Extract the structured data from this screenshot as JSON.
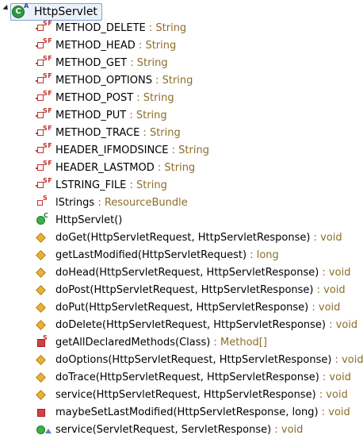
{
  "class": {
    "name": "HttpServlet",
    "modifier": "A"
  },
  "fields": [
    {
      "name": "METHOD_DELETE",
      "type": ": String",
      "mods": "SF"
    },
    {
      "name": "METHOD_HEAD",
      "type": ": String",
      "mods": "SF"
    },
    {
      "name": "METHOD_GET",
      "type": ": String",
      "mods": "SF"
    },
    {
      "name": "METHOD_OPTIONS",
      "type": ": String",
      "mods": "SF"
    },
    {
      "name": "METHOD_POST",
      "type": ": String",
      "mods": "SF"
    },
    {
      "name": "METHOD_PUT",
      "type": ": String",
      "mods": "SF"
    },
    {
      "name": "METHOD_TRACE",
      "type": ": String",
      "mods": "SF"
    },
    {
      "name": "HEADER_IFMODSINCE",
      "type": ": String",
      "mods": "SF"
    },
    {
      "name": "HEADER_LASTMOD",
      "type": ": String",
      "mods": "SF"
    },
    {
      "name": "LSTRING_FILE",
      "type": ": String",
      "mods": "SF"
    },
    {
      "name": "lStrings",
      "type": ": ResourceBundle",
      "mods": "S"
    }
  ],
  "constructor": {
    "name": "HttpServlet()",
    "mods": "C"
  },
  "methods": [
    {
      "name": "doGet(HttpServletRequest, HttpServletResponse)",
      "type": ": void"
    },
    {
      "name": "getLastModified(HttpServletRequest)",
      "type": ": long"
    },
    {
      "name": "doHead(HttpServletRequest, HttpServletResponse)",
      "type": ": void"
    },
    {
      "name": "doPost(HttpServletRequest, HttpServletResponse)",
      "type": ": void"
    },
    {
      "name": "doPut(HttpServletRequest, HttpServletResponse)",
      "type": ": void"
    },
    {
      "name": "doDelete(HttpServletRequest, HttpServletResponse)",
      "type": ": void"
    },
    {
      "name": "getAllDeclaredMethods(Class)",
      "type": ": Method[]",
      "mods": "S"
    },
    {
      "name": "doOptions(HttpServletRequest, HttpServletResponse)",
      "type": ": void"
    },
    {
      "name": "doTrace(HttpServletRequest, HttpServletResponse)",
      "type": ": void"
    },
    {
      "name": "service(HttpServletRequest, HttpServletResponse)",
      "type": ": void"
    },
    {
      "name": "maybeSetLastModified(HttpServletResponse, long)",
      "type": ": void"
    },
    {
      "name": "service(ServletRequest, ServletResponse)",
      "type": ": void"
    }
  ]
}
